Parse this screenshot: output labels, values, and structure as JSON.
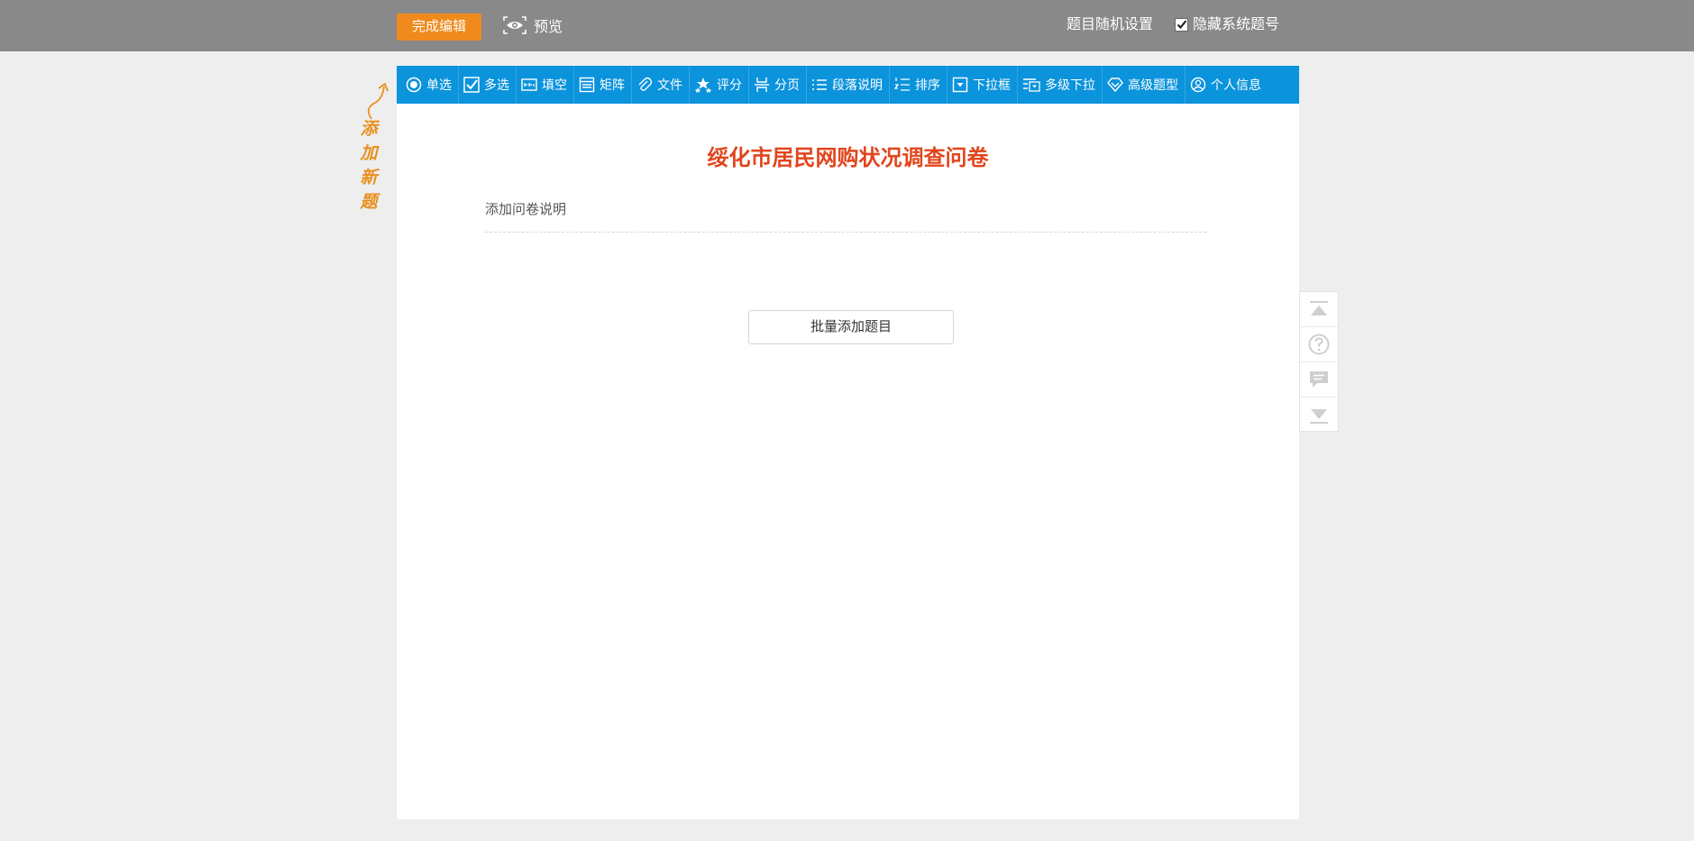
{
  "topbar": {
    "finish_label": "完成编辑",
    "preview_label": "预览",
    "random_label": "题目随机设置",
    "hide_number_label": "隐藏系统题号",
    "hide_number_checked": true
  },
  "hint": {
    "chars": [
      "添",
      "加",
      "新",
      "题"
    ]
  },
  "toolbar": {
    "items": [
      {
        "label": "单选",
        "icon": "radio-icon"
      },
      {
        "label": "多选",
        "icon": "checkbox-icon"
      },
      {
        "label": "填空",
        "icon": "fill-blank-icon"
      },
      {
        "label": "矩阵",
        "icon": "matrix-icon"
      },
      {
        "label": "文件",
        "icon": "paperclip-icon"
      },
      {
        "label": "评分",
        "icon": "stars-icon"
      },
      {
        "label": "分页",
        "icon": "page-break-icon"
      },
      {
        "label": "段落说明",
        "icon": "paragraph-list-icon"
      },
      {
        "label": "排序",
        "icon": "sort-list-icon"
      },
      {
        "label": "下拉框",
        "icon": "dropdown-icon"
      },
      {
        "label": "多级下拉",
        "icon": "multi-dropdown-icon"
      },
      {
        "label": "高级题型",
        "icon": "diamond-icon"
      },
      {
        "label": "个人信息",
        "icon": "user-icon"
      }
    ]
  },
  "survey": {
    "title": "绥化市居民网购状况调查问卷",
    "description": "添加问卷说明",
    "batch_add_label": "批量添加题目"
  },
  "colors": {
    "topbar": "#898989",
    "accent_orange": "#f08a1c",
    "toolbar_blue": "#0b93dc",
    "title_red": "#e2451c",
    "hint_orange": "#e8901e"
  }
}
